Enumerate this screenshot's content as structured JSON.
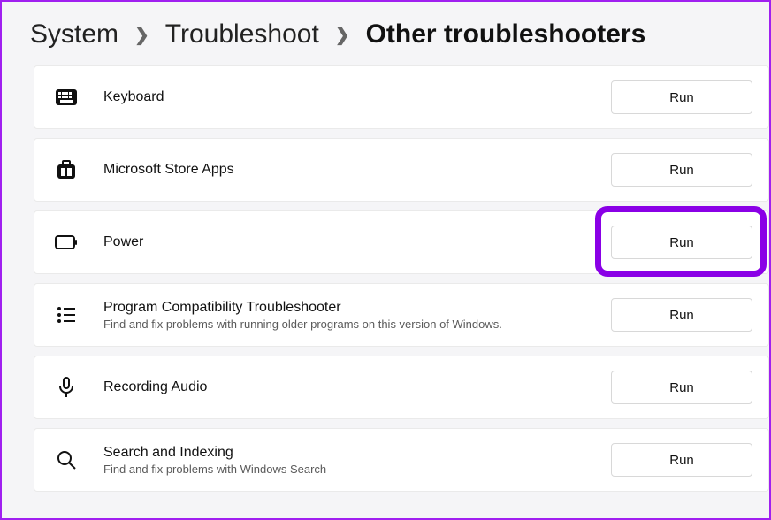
{
  "breadcrumb": {
    "system": "System",
    "troubleshoot": "Troubleshoot",
    "current": "Other troubleshooters"
  },
  "run_label": "Run",
  "items": [
    {
      "icon": "keyboard-icon",
      "title": "Keyboard",
      "subtitle": ""
    },
    {
      "icon": "store-icon",
      "title": "Microsoft Store Apps",
      "subtitle": ""
    },
    {
      "icon": "power-icon",
      "title": "Power",
      "subtitle": "",
      "highlighted": true
    },
    {
      "icon": "list-icon",
      "title": "Program Compatibility Troubleshooter",
      "subtitle": "Find and fix problems with running older programs on this version of Windows."
    },
    {
      "icon": "mic-icon",
      "title": "Recording Audio",
      "subtitle": ""
    },
    {
      "icon": "search-icon",
      "title": "Search and Indexing",
      "subtitle": "Find and fix problems with Windows Search"
    }
  ],
  "highlight_color": "#8a00e6"
}
